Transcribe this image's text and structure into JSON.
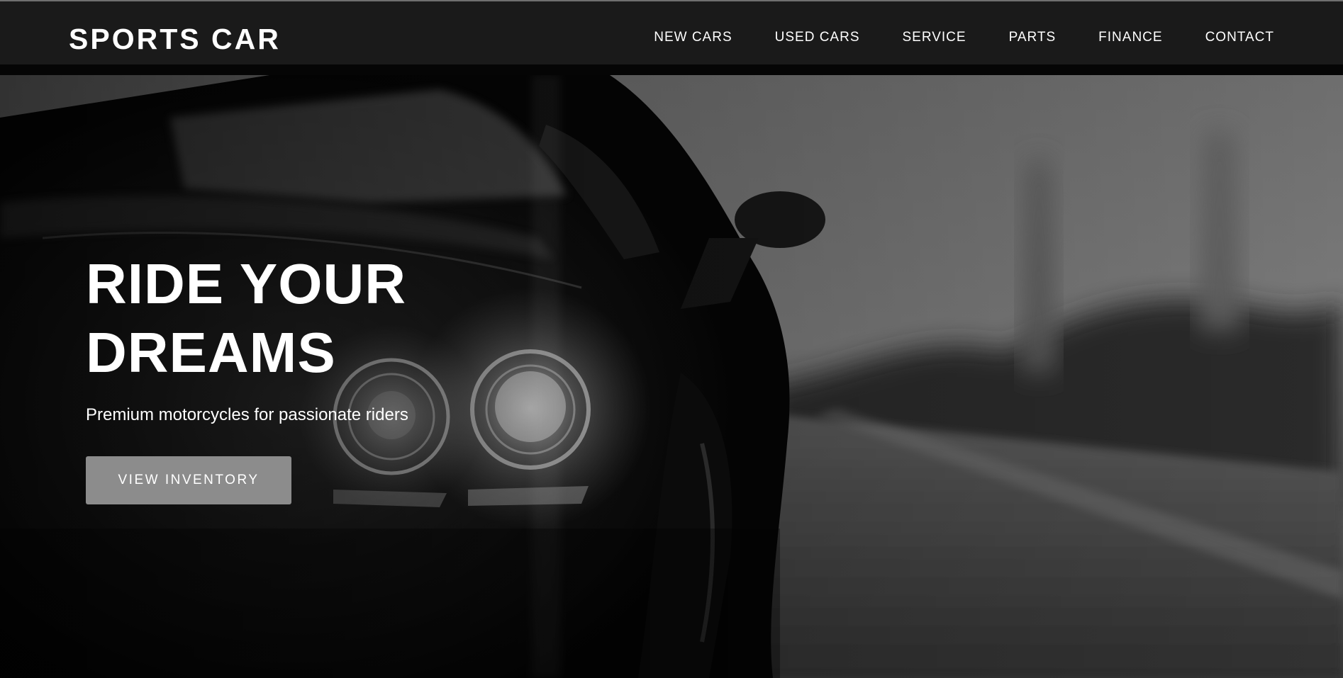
{
  "header": {
    "logo": "SPORTS CAR",
    "nav": [
      {
        "label": "NEW CARS"
      },
      {
        "label": "USED CARS"
      },
      {
        "label": "SERVICE"
      },
      {
        "label": "PARTS"
      },
      {
        "label": "FINANCE"
      },
      {
        "label": "CONTACT"
      }
    ]
  },
  "hero": {
    "title_line1": "RIDE YOUR",
    "title_line2": "DREAMS",
    "subtitle": "Premium motorcycles for passionate riders",
    "cta_label": "VIEW INVENTORY",
    "background_image": "black-sports-car-headlights-on-road-grayscale"
  },
  "colors": {
    "header_bg": "#1a1a1a",
    "text": "#ffffff",
    "button_bg": "#8c8c8c"
  }
}
